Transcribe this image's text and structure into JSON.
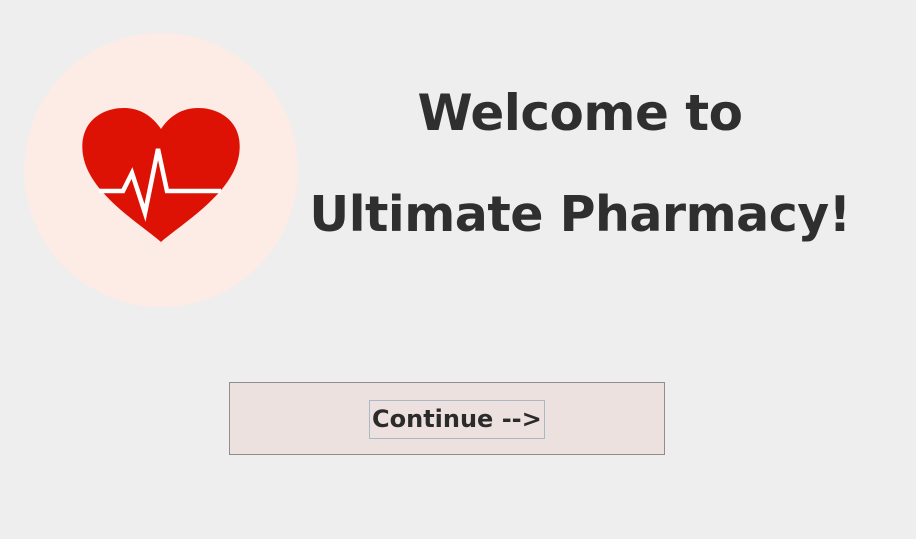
{
  "logo": {
    "icon": "heart-pulse-icon",
    "circle_color": "#fdebe5",
    "heart_color": "#de1204"
  },
  "welcome": {
    "line1": "Welcome to",
    "line2": "Ultimate Pharmacy!"
  },
  "continue_button": {
    "label": "Continue -->"
  }
}
